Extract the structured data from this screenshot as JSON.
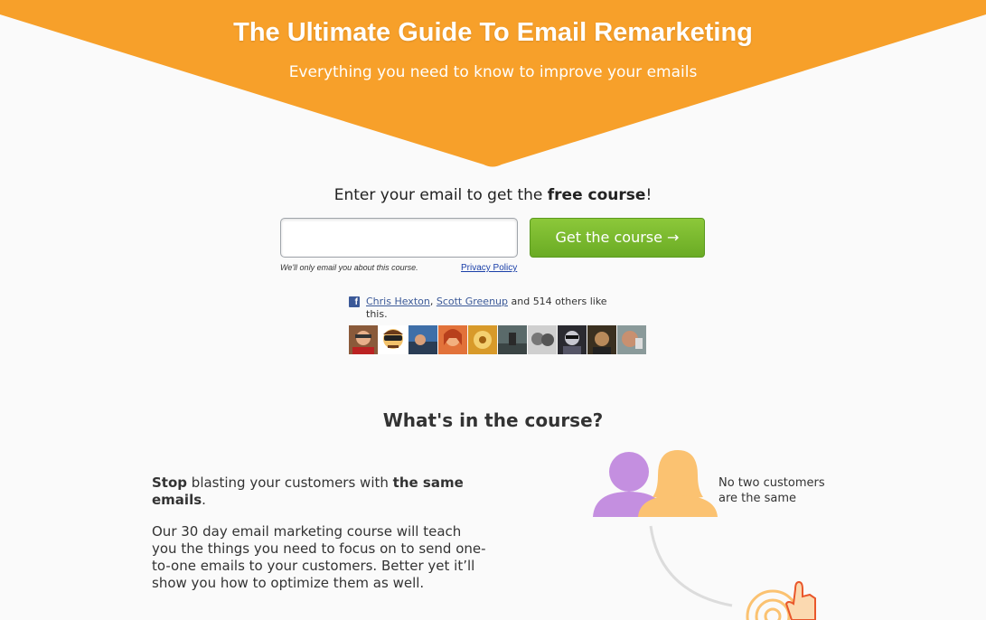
{
  "hero": {
    "title": "The Ultimate Guide To Email Remarketing",
    "subtitle": "Everything you need to know to improve your emails",
    "color": "#f7a02a"
  },
  "signup": {
    "heading_prefix": "Enter your email to get the ",
    "heading_bold": "free course",
    "heading_suffix": "!",
    "email_value": "",
    "email_placeholder": "",
    "button_label": "Get the course →",
    "button_color": "#7bbb30",
    "fine_print": "We'll only email you about this course.",
    "privacy_link": "Privacy Policy"
  },
  "facebook": {
    "icon": "facebook-icon",
    "friend1": "Chris Hexton",
    "separator": ", ",
    "friend2": "Scott Greenup",
    "rest": " and 514 others like this."
  },
  "course": {
    "heading": "What's in the course?",
    "p1_bold1": "Stop",
    "p1_text": " blasting your customers with ",
    "p1_bold2": "the same emails",
    "p1_end": ".",
    "p2": "Our 30 day email marketing course will teach you the things you need to focus on to send one-to-one emails to your customers. Better yet it’ll show you how to optimize them as well.",
    "illustration_caption": "No two customers are the same"
  }
}
